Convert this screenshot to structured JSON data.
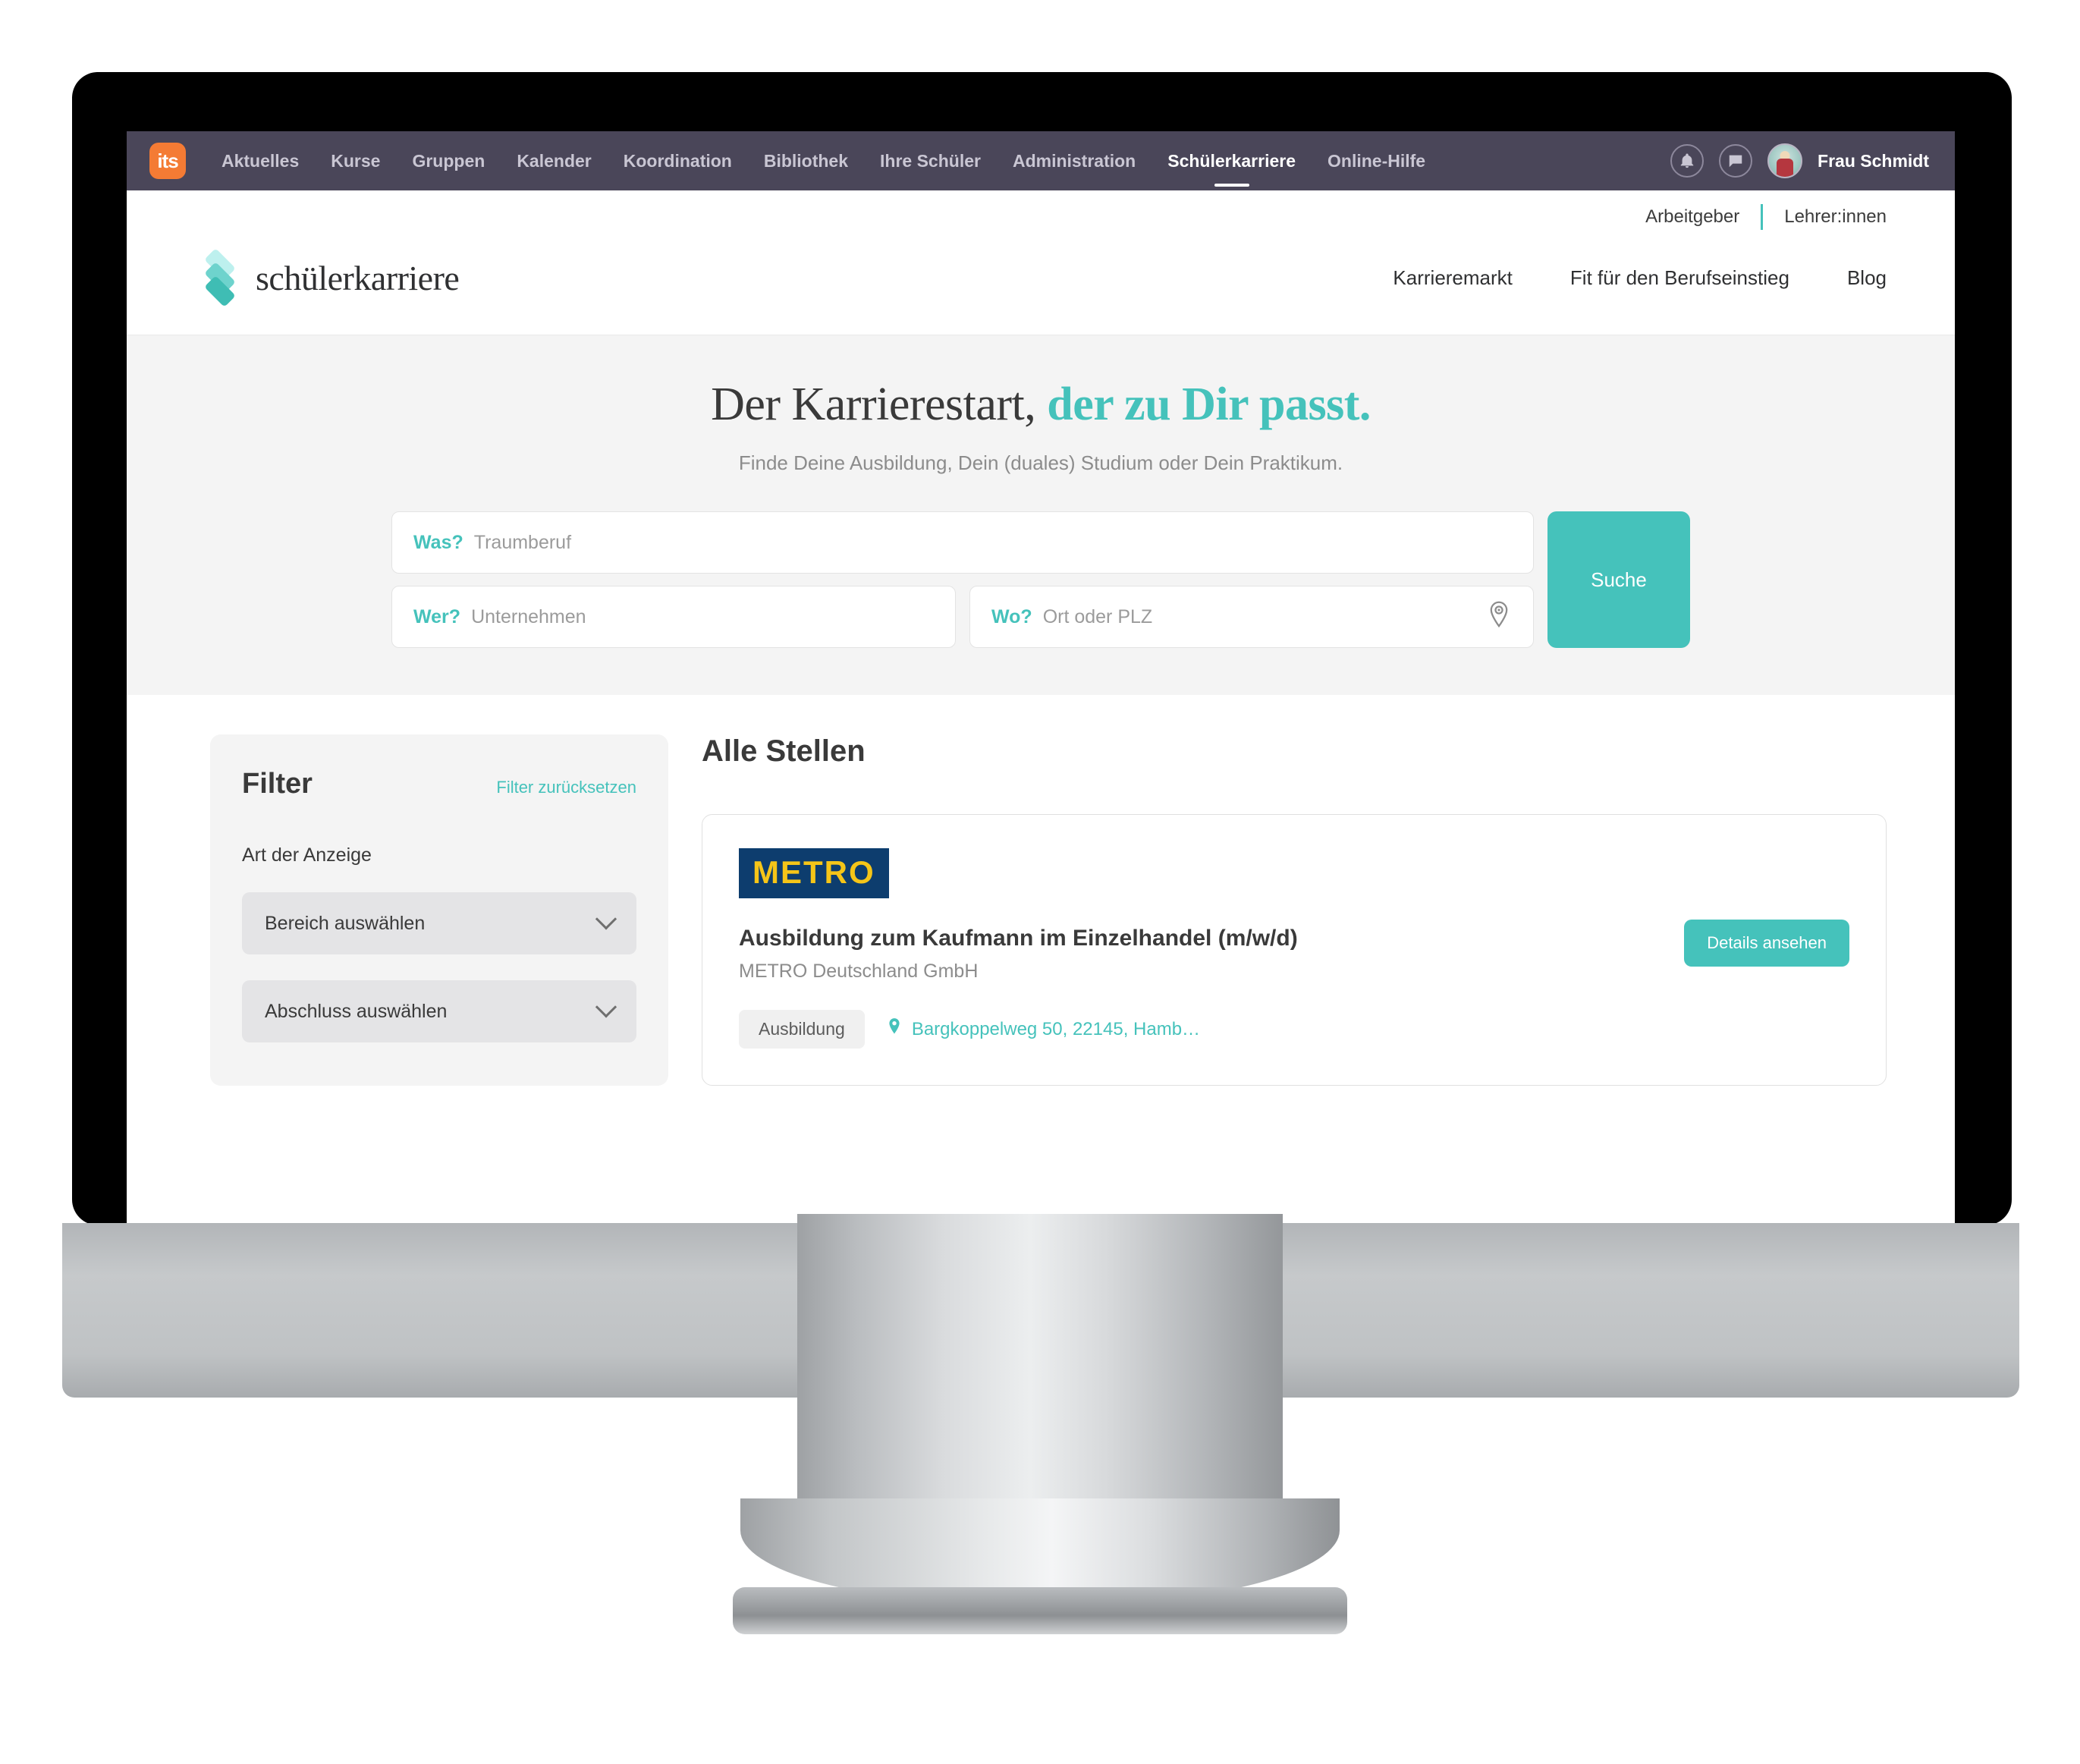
{
  "its_nav": {
    "logo_text": "its",
    "items": [
      {
        "label": "Aktuelles",
        "active": false
      },
      {
        "label": "Kurse",
        "active": false
      },
      {
        "label": "Gruppen",
        "active": false
      },
      {
        "label": "Kalender",
        "active": false
      },
      {
        "label": "Koordination",
        "active": false
      },
      {
        "label": "Bibliothek",
        "active": false
      },
      {
        "label": "Ihre Schüler",
        "active": false
      },
      {
        "label": "Administration",
        "active": false
      },
      {
        "label": "Schülerkarriere",
        "active": true
      },
      {
        "label": "Online-Hilfe",
        "active": false
      }
    ],
    "notification_icon": "bell-icon",
    "messages_icon": "chat-bubble-icon",
    "user_name": "Frau Schmidt"
  },
  "site_header": {
    "utility": {
      "employers_label": "Arbeitgeber",
      "teachers_label": "Lehrer:innen"
    },
    "brand_name": "schülerkarriere",
    "brand_logo_icon": "stacked-layers-icon",
    "menu": [
      {
        "label": "Karrieremarkt"
      },
      {
        "label": "Fit für den Berufseinstieg"
      },
      {
        "label": "Blog"
      }
    ]
  },
  "hero": {
    "title_plain": "Der Karrierestart, ",
    "title_accent": "der zu Dir passt.",
    "subtitle": "Finde Deine Ausbildung, Dein (duales) Studium oder Dein Praktikum.",
    "search": {
      "what_label": "Was?",
      "what_placeholder": "Traumberuf",
      "what_value": "",
      "who_label": "Wer?",
      "who_placeholder": "Unternehmen",
      "who_value": "",
      "where_label": "Wo?",
      "where_placeholder": "Ort oder PLZ",
      "where_value": "",
      "location_icon": "map-pin-icon",
      "submit_label": "Suche"
    }
  },
  "filters": {
    "title": "Filter",
    "reset_label": "Filter zurücksetzen",
    "group_label": "Art der Anzeige",
    "selects": [
      {
        "label": "Bereich auswählen",
        "icon": "chevron-down-icon"
      },
      {
        "label": "Abschluss auswählen",
        "icon": "chevron-down-icon"
      }
    ]
  },
  "results": {
    "title": "Alle Stellen",
    "jobs": [
      {
        "company_logo_text": "METRO",
        "title": "Ausbildung zum Kaufmann im Einzelhandel (m/w/d)",
        "company": "METRO Deutschland GmbH",
        "tag": "Ausbildung",
        "location": "Bargkoppelweg 50, 22145, Hamb…",
        "location_icon": "map-pin-icon",
        "cta_label": "Details ansehen"
      }
    ]
  },
  "colors": {
    "accent_teal": "#45c2bb",
    "nav_purple": "#4a4659",
    "its_orange": "#f47b34",
    "metro_blue": "#0d3d6e",
    "metro_yellow": "#f5c518"
  }
}
